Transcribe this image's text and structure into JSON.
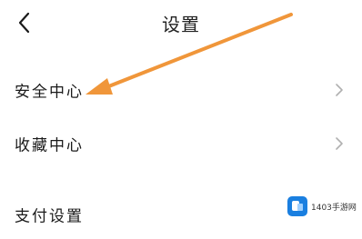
{
  "header": {
    "title": "设置"
  },
  "settings": {
    "items": [
      {
        "label": "安全中心",
        "has_chevron": true
      },
      {
        "label": "收藏中心",
        "has_chevron": true
      },
      {
        "label": "支付设置",
        "has_chevron": false
      }
    ]
  },
  "icons": {
    "back": "chevron-left-icon",
    "row_arrow": "chevron-right-icon"
  },
  "annotation": {
    "color": "#f0963a",
    "points_to": "安全中心"
  },
  "watermark": {
    "text": "1403手游网",
    "logo_color": "#1a7fe0"
  },
  "colors": {
    "background": "#ffffff",
    "text": "#1a1a1a",
    "chevron": "#b0b0b0"
  }
}
